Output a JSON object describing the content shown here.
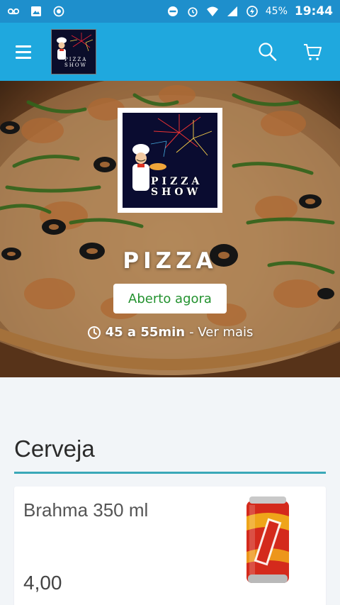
{
  "status_bar": {
    "battery": "45%",
    "time": "19:44",
    "icons": [
      "voicemail-icon",
      "image-icon",
      "record-icon",
      "do-not-disturb-icon",
      "alarm-icon",
      "wifi-icon",
      "signal-icon",
      "battery-charging-icon"
    ]
  },
  "app_bar": {
    "menu_icon": "menu-icon",
    "logo_text": "PIZZA SHOW",
    "search_icon": "search-icon",
    "cart_icon": "cart-icon",
    "accent": "#1fa8de"
  },
  "store": {
    "logo_text": "PIZZA SHOW",
    "name": "PIZZA",
    "status": "Aberto agora",
    "delivery_time": "45 a 55min",
    "more_link": "- Ver mais",
    "status_color": "#23922f"
  },
  "menu": {
    "section_title": "Cerveja",
    "products": [
      {
        "name": "Brahma 350 ml",
        "price": "4,00",
        "image": "brahma-can"
      }
    ]
  }
}
